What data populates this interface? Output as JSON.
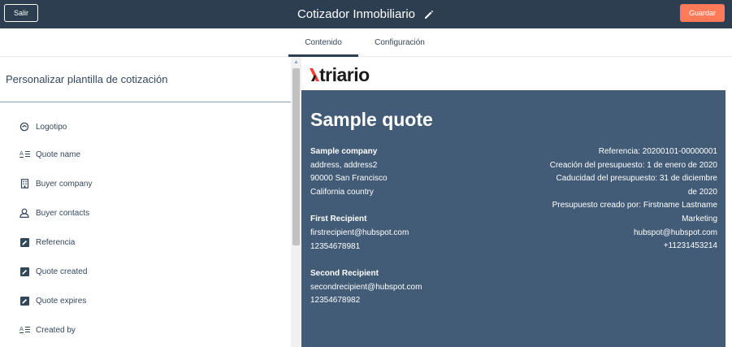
{
  "topbar": {
    "exit_label": "Salir",
    "title": "Cotizador Inmobiliario",
    "save_label": "Guardar"
  },
  "tabs": [
    {
      "label": "Contenido",
      "active": true
    },
    {
      "label": "Configuración",
      "active": false
    }
  ],
  "sidebar": {
    "title": "Personalizar plantilla de cotización",
    "items": [
      {
        "label": "Logotipo",
        "icon": "logo-circle-icon"
      },
      {
        "label": "Quote name",
        "icon": "text-format-icon"
      },
      {
        "label": "Buyer company",
        "icon": "building-icon"
      },
      {
        "label": "Buyer contacts",
        "icon": "contact-icon"
      },
      {
        "label": "Referencia",
        "icon": "pencil-square-icon"
      },
      {
        "label": "Quote created",
        "icon": "pencil-square-icon"
      },
      {
        "label": "Quote expires",
        "icon": "pencil-square-icon"
      },
      {
        "label": "Created by",
        "icon": "text-format-icon"
      }
    ]
  },
  "preview": {
    "logo_text": "triario",
    "quote_title": "Sample quote",
    "company": {
      "name": "Sample company",
      "address": "address, address2",
      "city": "90000 San Francisco",
      "country": "California country"
    },
    "first_recipient": {
      "name": "First Recipient",
      "email": "firstrecipient@hubspot.com",
      "phone": "12354678981"
    },
    "second_recipient": {
      "name": "Second Recipient",
      "email": "secondrecipient@hubspot.com",
      "phone": "12354678982"
    },
    "details": {
      "reference": "Referencia: 20200101-00000001",
      "created": "Creación del presupuesto: 1 de enero de 2020",
      "expires_line1": "Caducidad del presupuesto: 31 de diciembre",
      "expires_line2": "de 2020",
      "created_by_line1": "Presupuesto creado por: Firstname Lastname",
      "created_by_line2": "Marketing",
      "email": "hubspot@hubspot.com",
      "phone": "+11231453214"
    }
  },
  "colors": {
    "topbar_bg": "#2d3e50",
    "accent": "#ff7a59",
    "quote_bg": "#425b76",
    "logo_accent": "#ff3b2f"
  }
}
